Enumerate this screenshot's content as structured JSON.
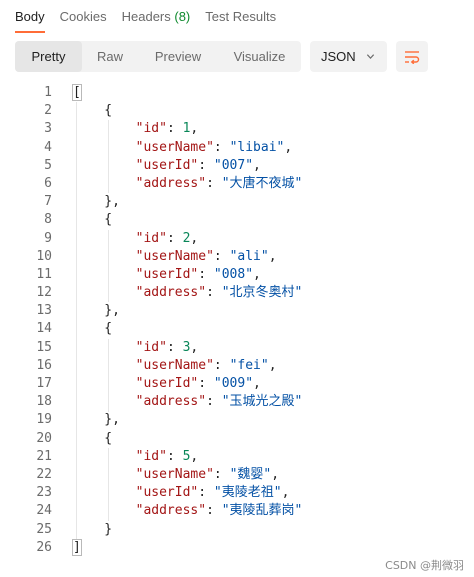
{
  "tabs": [
    {
      "label": "Body",
      "active": true
    },
    {
      "label": "Cookies",
      "active": false
    },
    {
      "label": "Headers",
      "count": "(8)",
      "active": false
    },
    {
      "label": "Test Results",
      "active": false
    }
  ],
  "view_modes": {
    "pretty": "Pretty",
    "raw": "Raw",
    "preview": "Preview",
    "visualize": "Visualize",
    "selected": "Pretty"
  },
  "format": {
    "selected": "JSON"
  },
  "colors": {
    "accent": "#ff6c37",
    "key": "#a31515",
    "string": "#0451a5",
    "number": "#098658",
    "count": "#0f8a2e"
  },
  "response": {
    "line_numbers": [
      "1",
      "2",
      "3",
      "4",
      "5",
      "6",
      "7",
      "8",
      "9",
      "10",
      "11",
      "12",
      "13",
      "14",
      "15",
      "16",
      "17",
      "18",
      "19",
      "20",
      "21",
      "22",
      "23",
      "24",
      "25",
      "26"
    ],
    "records": [
      {
        "id": "1",
        "userName": "libai",
        "userId": "007",
        "address": "大唐不夜城"
      },
      {
        "id": "2",
        "userName": "ali",
        "userId": "008",
        "address": "北京冬奥村"
      },
      {
        "id": "3",
        "userName": "fei",
        "userId": "009",
        "address": "玉城光之殿"
      },
      {
        "id": "5",
        "userName": "魏婴",
        "userId": "夷陵老祖",
        "address": "夷陵乱葬岗"
      }
    ]
  },
  "watermark": "CSDN @荆微羽"
}
